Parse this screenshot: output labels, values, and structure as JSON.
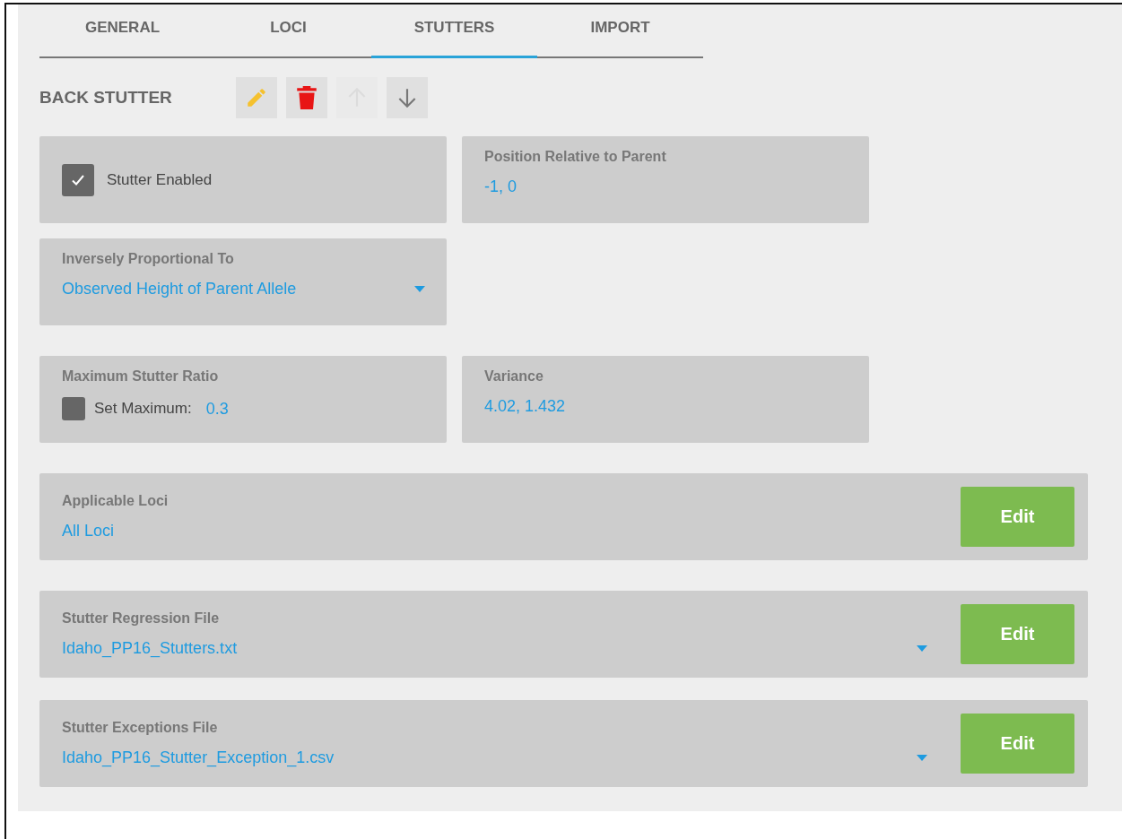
{
  "tabs": [
    {
      "label": "GENERAL",
      "selected": false
    },
    {
      "label": "LOCI",
      "selected": false
    },
    {
      "label": "STUTTERS",
      "selected": true
    },
    {
      "label": "IMPORT",
      "selected": false
    }
  ],
  "section": {
    "title": "BACK STUTTER",
    "tools": [
      {
        "kind": "edit",
        "disabled": false
      },
      {
        "kind": "delete",
        "disabled": false
      },
      {
        "kind": "up",
        "disabled": true
      },
      {
        "kind": "down",
        "disabled": false
      }
    ]
  },
  "stutter_enabled": {
    "label": "Stutter Enabled",
    "checked": true
  },
  "position": {
    "label": "Position Relative to Parent",
    "value": "-1, 0"
  },
  "inversely_proportional": {
    "label": "Inversely Proportional To",
    "value": "Observed Height of Parent Allele"
  },
  "max_stutter_ratio": {
    "label": "Maximum Stutter Ratio",
    "checkbox_label": "Set Maximum:",
    "checked": false,
    "value": "0.3"
  },
  "variance": {
    "label": "Variance",
    "value": "4.02, 1.432"
  },
  "wide_cards": [
    {
      "label": "Applicable Loci",
      "value": "All Loci",
      "dropdown": false,
      "button": "Edit"
    },
    {
      "label": "Stutter Regression File",
      "value": "Idaho_PP16_Stutters.txt",
      "dropdown": true,
      "button": "Edit"
    },
    {
      "label": "Stutter Exceptions File",
      "value": "Idaho_PP16_Stutter_Exception_1.csv",
      "dropdown": true,
      "button": "Edit"
    }
  ]
}
